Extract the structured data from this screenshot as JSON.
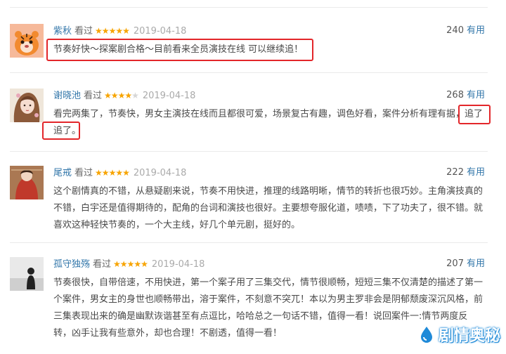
{
  "reviews": [
    {
      "user": "紫秋",
      "status": "看过",
      "rating": 5,
      "date": "2019-04-18",
      "votes": "240",
      "vote_label": "有用",
      "text": "节奏好快～探案剧合格～目前看来全员演技在线 可以继续追！"
    },
    {
      "user": "谢晓池",
      "status": "看过",
      "rating": 4,
      "date": "2019-04-18",
      "votes": "268",
      "vote_label": "有用",
      "text": "看完两集了，节奏快，男女主演技在线而且都很可爱，场景复古有趣，调色好看，案件分析有理有据，追了追了。"
    },
    {
      "user": "尾戒",
      "status": "看过",
      "rating": 5,
      "date": "2019-04-18",
      "votes": "222",
      "vote_label": "有用",
      "text": "这个剧情真的不错，从悬疑剧来说，节奏不用快进，推理的线路明晰，情节的转折也很巧妙。主角演技真的不错，白宇还是值得期待的，配角的台词和演技也很好。主要想夸服化道，啧啧，下了功夫了，很不错。就喜欢这种轻快节奏的，一个大主线，好几个单元剧，挺好的。"
    },
    {
      "user": "孤守独殇",
      "status": "看过",
      "rating": 5,
      "date": "2019-04-18",
      "votes": "207",
      "vote_label": "有用",
      "text": "节奏很快，自带倍速，不用快进，第一个案子用了三集交代，情节很顺畅，短短三集不仅清楚的描述了第一个案件，男女主的身世也顺畅带出，溶于案件，不刻意不突兀！本以为男主罗非会是阴郁颓废深沉风格，前三集表现出来的确是幽默诙谐甚至有点逗比，哈哈总之一句话不错，值得一看！说回案件一:情节两度反转，凶手让我有些意外，却也合理！不剧透，值得一看！"
    }
  ],
  "watermark": "剧情奥秘",
  "colors": {
    "link": "#3377aa",
    "star": "#f7a400",
    "highlight": "#e3262a"
  }
}
